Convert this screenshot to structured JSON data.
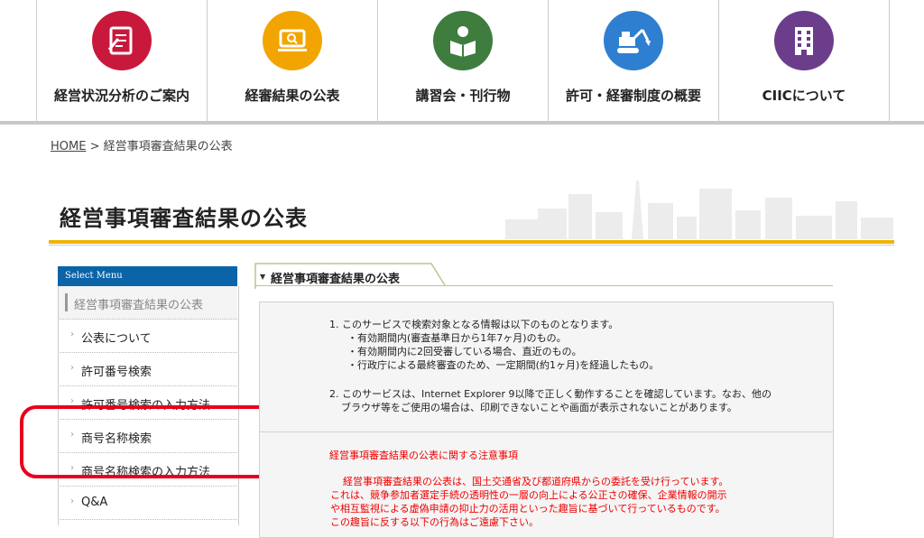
{
  "nav": {
    "items": [
      {
        "label": "経営状況分析のご案内",
        "color": "#c8193c",
        "icon": "document-pen-icon"
      },
      {
        "label": "経審結果の公表",
        "color": "#f2a500",
        "icon": "laptop-search-icon"
      },
      {
        "label": "講習会・刊行物",
        "color": "#3e7d3e",
        "icon": "person-reading-icon"
      },
      {
        "label": "許可・経審制度の概要",
        "color": "#2e7fd0",
        "icon": "excavator-icon"
      },
      {
        "label": "CIICについて",
        "color": "#6b3d8b",
        "icon": "building-icon"
      }
    ]
  },
  "breadcrumb": {
    "home": "HOME",
    "separator": ">",
    "current": "経営事項審査結果の公表"
  },
  "page": {
    "title": "経営事項審査結果の公表"
  },
  "sidebar": {
    "header": "Select Menu",
    "items": [
      {
        "label": "経営事項審査結果の公表"
      },
      {
        "label": "公表について"
      },
      {
        "label": "許可番号検索"
      },
      {
        "label": "許可番号検索の入力方法"
      },
      {
        "label": "商号名称検索"
      },
      {
        "label": "商号名称検索の入力方法"
      },
      {
        "label": "Q&A"
      }
    ]
  },
  "content": {
    "tab_label": "経営事項審査結果の公表",
    "notice": [
      "1. このサービスで検索対象となる情報は以下のものとなります。",
      "・有効期間内(審査基準日から1年7ヶ月)のもの。",
      "・有効期間内に2回受審している場合、直近のもの。",
      "・行政庁による最終審査のため、一定期間(約1ヶ月)を経過したもの。",
      "2. このサービスは、Internet Explorer 9以降で正しく動作することを確認しています。なお、他の",
      "ブラウザ等をご使用の場合は、印刷できないことや画面が表示されないことがあります。"
    ],
    "warning_title": "経営事項審査結果の公表に関する注意事項",
    "warning_lines": [
      "経営事項審査結果の公表は、国土交通省及び都道府県からの委託を受け行っています。",
      "これは、競争参加者選定手続の透明性の一層の向上による公正さの確保、企業情報の開示",
      "や相互監視による虚偽申請の抑止力の活用といった趣旨に基づいて行っているものです。",
      "この趣旨に反する以下の行為はご遠慮下さい。"
    ]
  }
}
